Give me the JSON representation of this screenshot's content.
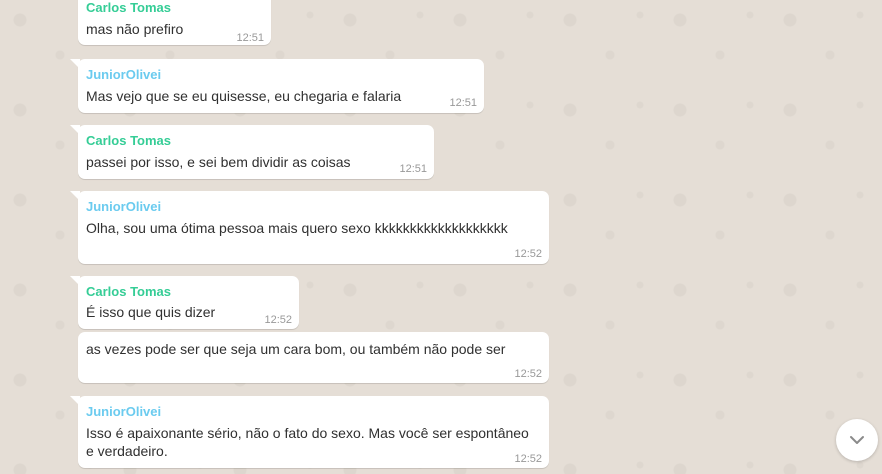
{
  "colors": {
    "carlos_name": "#35cd96",
    "junior_name": "#6bcbef",
    "bubble": "#ffffff",
    "text": "#303030",
    "timestamp": "#999999",
    "background": "#e5ded6"
  },
  "messages": [
    {
      "sender": "Carlos Tomas",
      "text": "mas não prefiro",
      "time": "12:51"
    },
    {
      "sender": "JuniorOlivei",
      "text": "Mas vejo que se eu quisesse, eu chegaria e falaria",
      "time": "12:51"
    },
    {
      "sender": "Carlos Tomas",
      "text": "passei por isso, e sei bem dividir as coisas",
      "time": "12:51"
    },
    {
      "sender": "JuniorOlivei",
      "text": "Olha, sou uma ótima pessoa mais quero sexo kkkkkkkkkkkkkkkkkkk",
      "time": "12:52"
    },
    {
      "sender": "Carlos Tomas",
      "text": "É isso que quis dizer",
      "time": "12:52"
    },
    {
      "text": "as vezes pode ser que seja um cara bom, ou também não pode ser",
      "time": "12:52"
    },
    {
      "sender": "JuniorOlivei",
      "text_line1": "Isso é apaixonante sério, não o fato do sexo. Mas você ser espontâneo",
      "text_line2": "e verdadeiro.",
      "time": "12:52"
    }
  ],
  "scroll_button": {
    "icon": "chevron-down-icon"
  }
}
